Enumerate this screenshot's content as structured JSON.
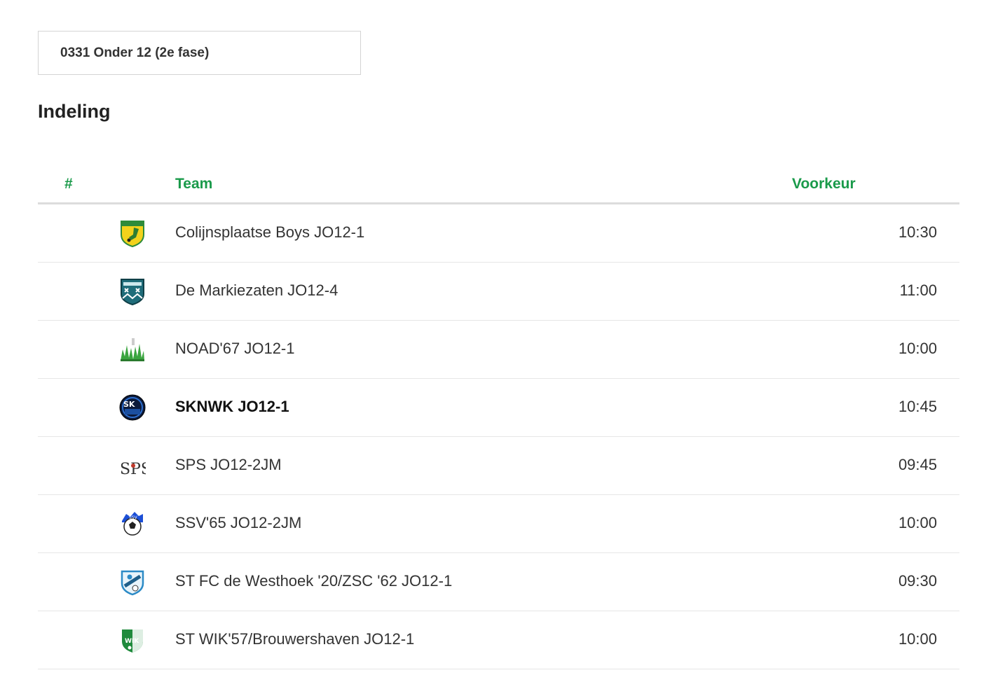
{
  "competition": {
    "label": "0331 Onder 12 (2e fase)"
  },
  "page_title": "Indeling",
  "table": {
    "headers": {
      "num": "#",
      "team": "Team",
      "preference": "Voorkeur"
    },
    "rows": [
      {
        "team": "Colijnsplaatse Boys JO12-1",
        "preference": "10:30",
        "logo": "colijnsplaatse-boys-logo"
      },
      {
        "team": "De Markiezaten JO12-4",
        "preference": "11:00",
        "logo": "de-markiezaten-logo"
      },
      {
        "team": "NOAD'67 JO12-1",
        "preference": "10:00",
        "logo": "noad67-logo"
      },
      {
        "team": "SKNWK JO12-1",
        "preference": "10:45",
        "logo": "sknwk-logo"
      },
      {
        "team": "SPS JO12-2JM",
        "preference": "09:45",
        "logo": "sps-logo"
      },
      {
        "team": "SSV'65 JO12-2JM",
        "preference": "10:00",
        "logo": "ssv65-logo"
      },
      {
        "team": "ST FC de Westhoek '20/ZSC '62 JO12-1",
        "preference": "09:30",
        "logo": "westhoek-logo"
      },
      {
        "team": "ST WIK'57/Brouwershaven JO12-1",
        "preference": "10:00",
        "logo": "wik57-logo"
      }
    ]
  },
  "colors": {
    "accent_green": "#1a9a4a",
    "text": "#333333",
    "border": "#dcdcdc"
  }
}
